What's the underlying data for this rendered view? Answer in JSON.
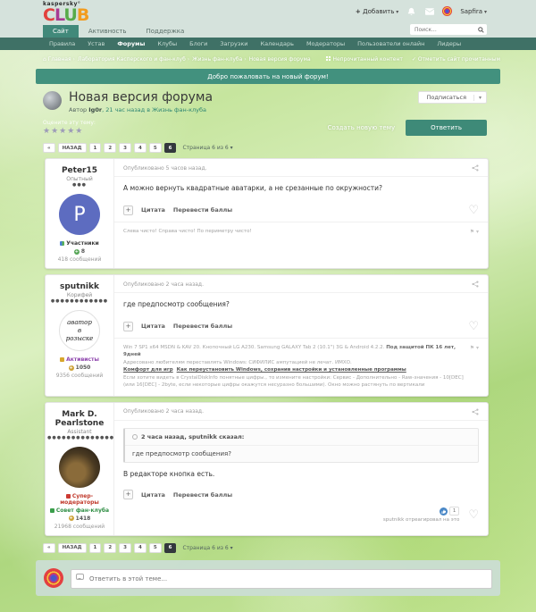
{
  "brand": {
    "name": "kaspersky°",
    "club": [
      "C",
      "L",
      "U",
      "B"
    ]
  },
  "header": {
    "add_label": "Добавить",
    "username": "Sapfira",
    "tabs": [
      "Сайт",
      "Активность",
      "Поддержка"
    ],
    "search_placeholder": "Поиск...",
    "nav": [
      "Правила",
      "Устав",
      "Форумы",
      "Клубы",
      "Блоги",
      "Загрузки",
      "Календарь",
      "Модераторы",
      "Пользователи онлайн",
      "Лидеры"
    ]
  },
  "breadcrumb": {
    "items": [
      "Главная",
      "Лаборатория Касперского и фан-клуб",
      "Жизнь фан-клуба",
      "Новая версия форума"
    ],
    "unread": "Непрочитанный контент",
    "mark_read": "Отметить сайт прочитанным"
  },
  "banner": {
    "text": "Добро пожаловать на новый форум!"
  },
  "topic": {
    "title": "Новая версия форума",
    "author_prefix": "Автор",
    "author": "Ig0r",
    "time_info": ", 21 час назад в",
    "forum": "Жизнь фан-клуба",
    "subscribe_label": "Подписаться",
    "rate_label": "Оцените эту тему:",
    "stars": "★★★★★",
    "create_topic_label": "Создать новую тему",
    "reply_label": "Ответить"
  },
  "pagination": {
    "first": "«",
    "back": "НАЗАД",
    "pages": [
      "1",
      "2",
      "3",
      "4",
      "5"
    ],
    "current": "6",
    "info": "Страница 6 из 6 ▾"
  },
  "actions": {
    "multiquote": "+",
    "quote": "Цитата",
    "transfer": "Перевести баллы"
  },
  "posts": [
    {
      "author": "Peter15",
      "rank": "Опытный",
      "pips": "●●●",
      "avatar_letter": "P",
      "group": "Участники",
      "reputation": "8",
      "messages": "418 сообщений",
      "posted": "Опубликовано 5 часов назад.",
      "body": "А можно вернуть квадратные аватарки, а не срезанные по окружности?",
      "signature": "Слева чисто! Справа чисто! По периметру чисто!"
    },
    {
      "author": "sputnikk",
      "rank": "Корифей",
      "pips": "●●●●●●●●●●●●",
      "avatar_line1": "аватор",
      "avatar_line2": "в",
      "avatar_line3": "розыске",
      "group": "Активисты",
      "reputation": "1050",
      "messages": "9356 сообщений",
      "posted": "Опубликовано 2 часа назад.",
      "body": "где предпосмотр сообщения?",
      "sig_line1": "Win 7 SP1 x64 MSDN & KAV 20. Кнопочный LG A230.  Samsung GALAXY Tab 2 (10.1\") 3G & Android 4.2.2.",
      "sig_line1_bold": "Под защитой ПК 16 лет, 9дней",
      "sig_line2": "Адресовано любителям переставлять Windows: СИФИЛИС ампутацией не лечат. ИМХО.",
      "sig_link1": "Комфорт для игр",
      "sig_link2": "Как переустановить Windows, сохранив настройки и установленные программы",
      "sig_line4": "Если хотите видеть в CrystalDiskInfo понятные цифры., то измените настройки: Сервис - Дополнительно - Raw-значения - 10[DEC] (или 16[DEC] - 2byte, если некоторые цифры окажутся несуразно большими). Окно можно растянуть по вертикали"
    },
    {
      "author": "Mark D. Pearlstone",
      "rank": "Assistant",
      "pips": "●●●●●●●●●●●●●●",
      "group1": "Супер-модераторы",
      "group2": "Совет фан-клуба",
      "reputation": "1418",
      "messages": "21968 сообщений",
      "posted": "Опубликовано 2 часа назад.",
      "quote_header": "2 часа назад, sputnikk сказал:",
      "quote_body": "где предпосмотр сообщения?",
      "body": "В редакторе кнопка есть.",
      "reaction_count": "1",
      "reaction_text": "sputnikk отреагировал на это"
    }
  ],
  "reply": {
    "placeholder": "Ответить в этой теме..."
  }
}
